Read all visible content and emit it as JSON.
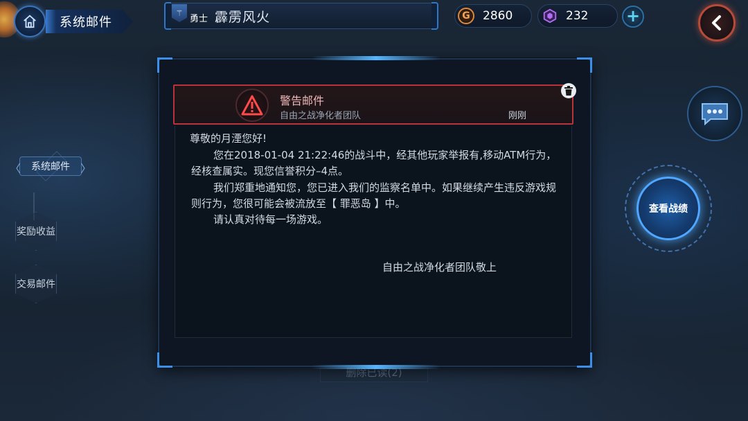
{
  "header": {
    "title": "系统邮件",
    "home_icon": "home-icon",
    "back_icon": "chevron-left-icon"
  },
  "player": {
    "rank_label": "勇士",
    "name": "霹雳风火"
  },
  "currencies": {
    "gold": {
      "symbol": "G",
      "value": "2860"
    },
    "gems": {
      "value": "232"
    }
  },
  "sidebar": {
    "items": [
      {
        "label": "系统邮件",
        "active": true
      },
      {
        "label": "奖励收益",
        "active": false
      },
      {
        "label": "交易邮件",
        "active": false
      }
    ]
  },
  "actions": {
    "view_stats": "查看战绩"
  },
  "mail": {
    "title": "警告邮件",
    "sender": "自由之战净化者团队",
    "time": "刚刚",
    "greeting": "尊敬的月湮您好!",
    "paragraphs": [
      "您在2018-01-04   21:22:46的战斗中，经其他玩家举报有,移动ATM行为，经核查属实。现您信誉积分–4点。",
      "我们郑重地通知您，您已进入我们的监察名单中。如果继续产生违反游戏规则行为，您很可能会被流放至【 罪恶岛 】中。",
      "请认真对待每一场游戏。"
    ],
    "signature": "自由之战净化者团队敬上"
  },
  "under_tab": {
    "label": "删除已读(2)"
  },
  "colors": {
    "accent_blue": "#3c8ee8",
    "warning_red": "#b8333a",
    "gold": "#e0883c",
    "gem_purple": "#9b5ad9"
  }
}
